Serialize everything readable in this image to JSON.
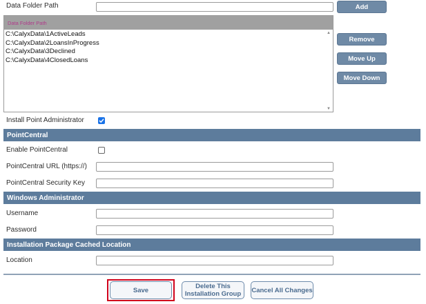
{
  "data_folder": {
    "label": "Data Folder Path",
    "input_value": "",
    "add_label": "Add",
    "list_header": "Data Folder Path",
    "items": [
      "C:\\CalyxData\\1ActiveLeads",
      "C:\\CalyxData\\2LoansInProgress",
      "C:\\CalyxData\\3Declined",
      "C:\\CalyxData\\4ClosedLoans"
    ],
    "remove_label": "Remove",
    "move_up_label": "Move Up",
    "move_down_label": "Move Down"
  },
  "install_admin": {
    "label": "Install Point Administrator",
    "checked": true
  },
  "pointcentral": {
    "header": "PointCentral",
    "enable_label": "Enable PointCentral",
    "enable_checked": false,
    "url_label": "PointCentral URL (https://)",
    "url_value": "",
    "key_label": "PointCentral Security Key",
    "key_value": ""
  },
  "windows_admin": {
    "header": "Windows Administrator",
    "username_label": "Username",
    "username_value": "",
    "password_label": "Password",
    "password_value": ""
  },
  "cache": {
    "header": "Installation Package Cached Location",
    "location_label": "Location",
    "location_value": ""
  },
  "footer": {
    "save_label": "Save",
    "delete_label": "Delete This Installation Group",
    "cancel_label": "Cancel All Changes",
    "save_highlight_color": "#d0021b"
  },
  "colors": {
    "section_header": "#5d7c9c",
    "side_button": "#6f8aa6",
    "checkbox_checked": "#1a73e8"
  }
}
